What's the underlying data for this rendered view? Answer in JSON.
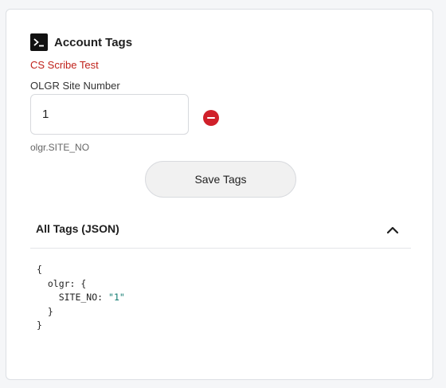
{
  "panel": {
    "title": "Account Tags",
    "title_icon": "terminal-icon",
    "subtitle": "CS Scribe Test",
    "subtitle_color": "#c0221b"
  },
  "tag_field": {
    "label": "OLGR Site Number",
    "value": "1",
    "hint": "olgr.SITE_NO",
    "remove_icon": "minus-circle-icon",
    "remove_color": "#d0202a"
  },
  "actions": {
    "save_label": "Save Tags"
  },
  "json_section": {
    "title": "All Tags (JSON)",
    "expanded": true,
    "toggle_icon": "chevron-up-icon",
    "lines": {
      "l1": "{",
      "l2": "  olgr: {",
      "l3_key": "    SITE_NO: ",
      "l3_value": "\"1\"",
      "l4": "  }",
      "l5": "}"
    }
  }
}
